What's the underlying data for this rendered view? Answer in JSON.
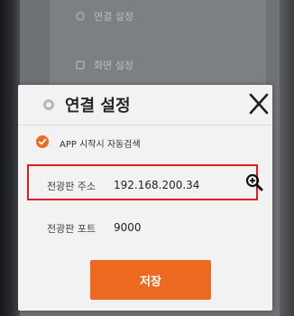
{
  "background_menu": {
    "items": [
      {
        "label": "연결 설정",
        "icon": "gear-icon"
      },
      {
        "label": "화면 설정",
        "icon": "screen-icon"
      }
    ]
  },
  "dialog": {
    "title": "연결 설정",
    "title_icon": "gear-icon",
    "close_label": "X",
    "auto_search": {
      "checked": true,
      "label": "APP 시작시 자동검색"
    },
    "ip": {
      "label": "전광판 주소",
      "value": "192.168.200.34",
      "action_icon": "zoom-in-icon"
    },
    "port": {
      "label": "전광판 포트",
      "value": "9000"
    },
    "save_label": "저장"
  },
  "colors": {
    "accent": "#ec6a1f",
    "highlight": "#e21c23"
  }
}
